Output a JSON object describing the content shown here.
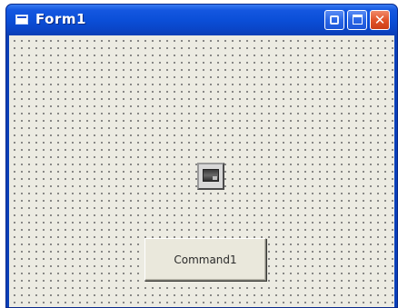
{
  "window": {
    "title": "Form1",
    "icons": {
      "system": "form-icon",
      "minimize": "minimize-icon",
      "maximize": "maximize-icon",
      "close": "close-icon"
    },
    "colors": {
      "titlebar": "#0b4fd8",
      "client_background": "#ecebe2",
      "close_button": "#e2542a"
    }
  },
  "form": {
    "controls": {
      "picture_box": {
        "icon": "picture-box-icon"
      },
      "command_button": {
        "label": "Command1"
      }
    }
  }
}
